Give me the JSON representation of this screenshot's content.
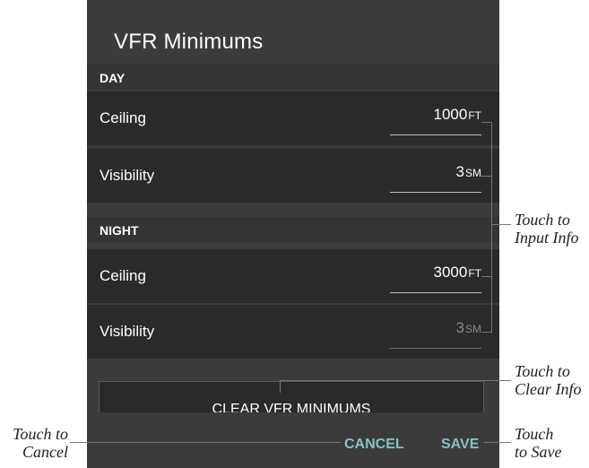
{
  "dialog": {
    "title": "VFR Minimums",
    "day": {
      "header": "DAY",
      "ceiling": {
        "label": "Ceiling",
        "value": "1000",
        "unit": "FT"
      },
      "visibility": {
        "label": "Visibility",
        "value": "3",
        "unit": "SM"
      }
    },
    "night": {
      "header": "NIGHT",
      "ceiling": {
        "label": "Ceiling",
        "value": "3000",
        "unit": "FT"
      },
      "visibility": {
        "label": "Visibility",
        "value": "3",
        "unit": "SM"
      }
    },
    "clear_button": "CLEAR VFR MINIMUMS",
    "cancel": "CANCEL",
    "save": "SAVE"
  },
  "callouts": {
    "input": [
      "Touch to",
      "Input Info"
    ],
    "clear": [
      "Touch to",
      "Clear Info"
    ],
    "cancel": [
      "Touch to",
      "Cancel"
    ],
    "save": [
      "Touch",
      "to Save"
    ]
  },
  "colors": {
    "dialog_bg": "#3b3b3b",
    "row_bg": "#2a2a2a",
    "accent": "#7fc6c3"
  }
}
